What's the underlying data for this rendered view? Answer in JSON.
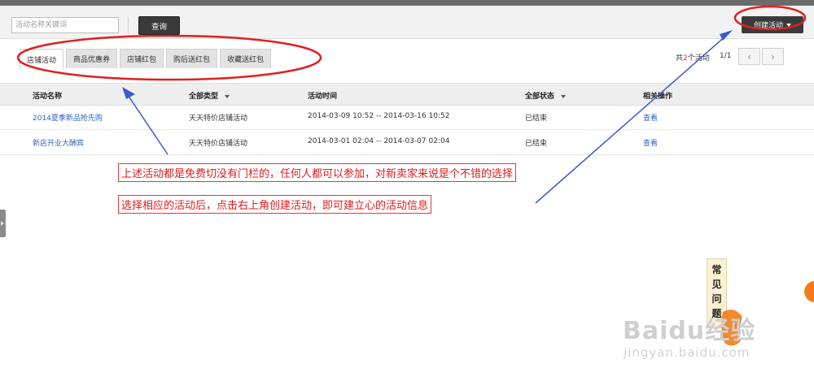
{
  "toolbar": {
    "search_placeholder": "活动名称关键词",
    "query_label": "查询",
    "create_label": "创建活动"
  },
  "tabs": [
    {
      "label": "店铺活动",
      "active": true
    },
    {
      "label": "商品优惠券",
      "active": false
    },
    {
      "label": "店铺红包",
      "active": false
    },
    {
      "label": "购后送红包",
      "active": false
    },
    {
      "label": "收藏送红包",
      "active": false
    }
  ],
  "pager": {
    "prefix": "共",
    "count": "2",
    "suffix": "个活动",
    "page": "1/1",
    "prev": "‹",
    "next": "›"
  },
  "table": {
    "headers": [
      "活动名称",
      "全部类型",
      "活动时间",
      "全部状态",
      "相关操作"
    ],
    "rows": [
      {
        "name": "2014夏季新品抢先购",
        "type": "天天特价店铺活动",
        "time": "2014-03-09 10:52 -- 2014-03-16 10:52",
        "status": "已结束",
        "action": "查看"
      },
      {
        "name": "新店开业大酬宾",
        "type": "天天特价店铺活动",
        "time": "2014-03-01 02:04 -- 2014-03-07 02:04",
        "status": "已结束",
        "action": "查看"
      }
    ]
  },
  "annotations": [
    "上述活动都是免费切没有门栏的，任何人都可以参加，对新卖家来说是个不错的选择",
    "选择相应的活动后，点击右上角创建活动，即可建立心的活动信息"
  ],
  "faq": [
    "常",
    "见",
    "问",
    "题"
  ],
  "watermark": {
    "main": "Baidu经验",
    "sub": "jingyan.baidu.com"
  },
  "colors": {
    "annotation": "#e01b1b",
    "arrow": "#3a5bd0",
    "link": "#2f63c0",
    "count": "#e02020"
  }
}
